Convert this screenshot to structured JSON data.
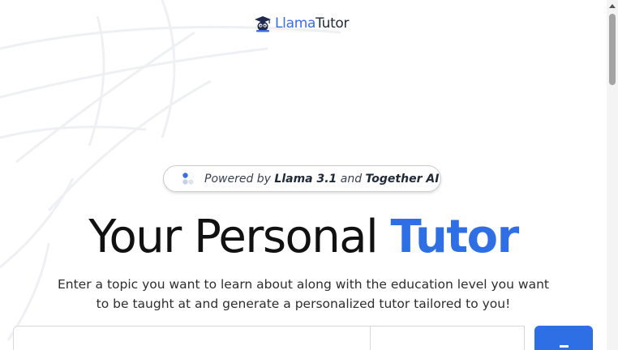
{
  "header": {
    "logo_llama": "Llama",
    "logo_tutor": "Tutor"
  },
  "pill": {
    "prefix": "Powered by ",
    "model": "Llama 3.1",
    "conjunction": " and ",
    "provider": "Together AI"
  },
  "hero": {
    "title_main": "Your Personal ",
    "title_accent": "Tutor",
    "description": "Enter a topic you want to learn about along with the education level you want to be taught at and generate a personalized tutor tailored to you!"
  },
  "search": {
    "topic_value": "",
    "level_value": ""
  },
  "colors": {
    "accent": "#2f6fe6",
    "logo_blue": "#3b6fe0"
  },
  "icons": {
    "logo": "llama-graduation-cap-icon",
    "pill": "dots-icon",
    "button": "arrow-right-icon"
  }
}
